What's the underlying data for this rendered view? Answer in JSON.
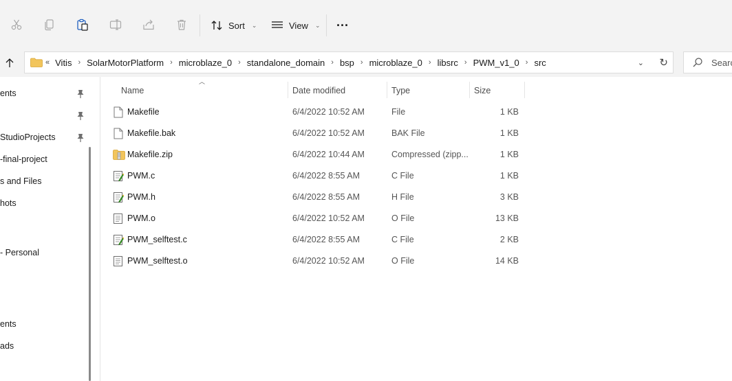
{
  "toolbar": {
    "sort_label": "Sort",
    "view_label": "View",
    "more_label": "···"
  },
  "address": {
    "overflow": "«",
    "crumbs": [
      "Vitis",
      "SolarMotorPlatform",
      "microblaze_0",
      "standalone_domain",
      "bsp",
      "microblaze_0",
      "libsrc",
      "PWM_v1_0",
      "src"
    ]
  },
  "search": {
    "placeholder": "Search"
  },
  "nav": {
    "items": [
      {
        "label": "ents",
        "pinned": true
      },
      {
        "label": "",
        "pinned": true
      },
      {
        "label": "StudioProjects",
        "pinned": true
      },
      {
        "label": "-final-project",
        "pinned": false
      },
      {
        "label": "s and Files",
        "pinned": false
      },
      {
        "label": "hots",
        "pinned": false
      },
      {
        "label": "- Personal",
        "pinned": false
      },
      {
        "label": "ents",
        "pinned": false
      },
      {
        "label": "ads",
        "pinned": false
      }
    ]
  },
  "columns": {
    "name": "Name",
    "date": "Date modified",
    "type": "Type",
    "size": "Size"
  },
  "files": [
    {
      "name": "Makefile",
      "date": "6/4/2022 10:52 AM",
      "type": "File",
      "size": "1 KB",
      "icon": "blank-file-icon"
    },
    {
      "name": "Makefile.bak",
      "date": "6/4/2022 10:52 AM",
      "type": "BAK File",
      "size": "1 KB",
      "icon": "blank-file-icon"
    },
    {
      "name": "Makefile.zip",
      "date": "6/4/2022 10:44 AM",
      "type": "Compressed (zipp...",
      "size": "1 KB",
      "icon": "zip-folder-icon"
    },
    {
      "name": "PWM.c",
      "date": "6/4/2022 8:55 AM",
      "type": "C File",
      "size": "1 KB",
      "icon": "source-file-icon"
    },
    {
      "name": "PWM.h",
      "date": "6/4/2022 8:55 AM",
      "type": "H File",
      "size": "3 KB",
      "icon": "source-file-icon"
    },
    {
      "name": "PWM.o",
      "date": "6/4/2022 10:52 AM",
      "type": "O File",
      "size": "13 KB",
      "icon": "text-file-icon"
    },
    {
      "name": "PWM_selftest.c",
      "date": "6/4/2022 8:55 AM",
      "type": "C File",
      "size": "2 KB",
      "icon": "source-file-icon"
    },
    {
      "name": "PWM_selftest.o",
      "date": "6/4/2022 10:52 AM",
      "type": "O File",
      "size": "14 KB",
      "icon": "text-file-icon"
    }
  ]
}
